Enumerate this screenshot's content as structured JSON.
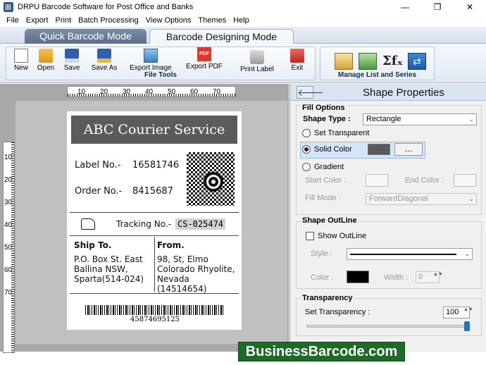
{
  "window": {
    "title": "DRPU Barcode Software for Post Office and Banks",
    "minimize": "—",
    "restore": "❐",
    "close": "✕"
  },
  "menu": [
    "File",
    "Export",
    "Print",
    "Batch Processing",
    "View Options",
    "Themes",
    "Help"
  ],
  "tabs": {
    "quick": "Quick Barcode Mode",
    "design": "Barcode Designing Mode"
  },
  "toolbar": {
    "file_group_label": "File Tools",
    "list_group_label": "Manage List and Series",
    "new": "New",
    "open": "Open",
    "save": "Save",
    "save_as": "Save As",
    "export_image": "Export Image",
    "export_pdf": "Export PDF",
    "pdf_badge": "PDF",
    "print_label": "Print Label",
    "exit": "Exit",
    "sigma_glyph": "Σfₓ",
    "series_glyph": "⇄"
  },
  "ruler": {
    "horizontal": [
      "10",
      "20",
      "30",
      "40",
      "50",
      "60",
      "70"
    ],
    "vertical": [
      "10",
      "20",
      "30",
      "40",
      "50",
      "60",
      "70"
    ]
  },
  "label": {
    "header": "ABC Courier Service",
    "label_no_caption": "Label No.-",
    "label_no_value": "16581746",
    "order_no_caption": "Order No.-",
    "order_no_value": "8415687",
    "tracking_caption": "Tracking No.-",
    "tracking_value": "CS-025474",
    "ship_to_caption": "Ship To.",
    "ship_to_lines": [
      "P.O. Box St. East",
      "Ballina NSW,",
      "Sparta(514-024)"
    ],
    "from_caption": "From.",
    "from_lines": [
      "98, St, Elmo",
      "Colorado Rhyolite,",
      "Nevada",
      "(14514654)"
    ],
    "barcode_number": "45874695125"
  },
  "panel": {
    "back_glyph": "🡐",
    "title": "Shape Properties",
    "fill_options": "Fill Options",
    "shape_type_label": "Shape Type :",
    "shape_type_value": "Rectangle",
    "set_transparent": "Set Transparent",
    "solid_color": "Solid Color",
    "solid_color_value": "#5a5a5a",
    "browse": "...",
    "gradient": "Gradient",
    "start_color": "Start Color :",
    "end_color": "End Color :",
    "fill_mode_label": "Fill Mode :",
    "fill_mode_value": "ForwardDiagonal",
    "shape_outline": "Shape OutLine",
    "show_outline": "Show OutLine",
    "style_label": "Style :",
    "color_label": "Color :",
    "outline_color": "#000000",
    "width_label": "Width :",
    "width_value": "0",
    "transparency": "Transparency",
    "set_transparency_label": "Set Transparency :",
    "transparency_value": "100",
    "transparency_fraction": 1.0,
    "dropdown_arrow": "⌄",
    "spin_arrows": "▲▼"
  },
  "brand": {
    "banner": "BusinessBarcode.com"
  }
}
